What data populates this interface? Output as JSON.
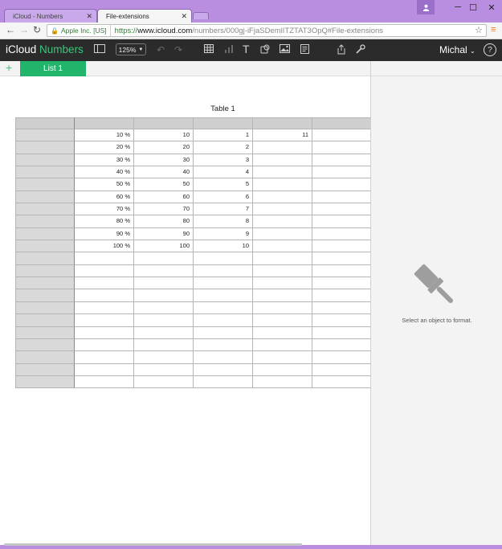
{
  "browser": {
    "tabs": [
      {
        "title": "iCloud - Numbers",
        "active": false
      },
      {
        "title": "File-extensions",
        "active": true
      }
    ],
    "security_label": "Apple Inc. [US]",
    "url_scheme": "https://",
    "url_host": "www.icloud.com",
    "url_path": "/numbers/000gj-iFjaSDemlITZTAT3OpQ#File-extensions"
  },
  "app": {
    "brand_prefix": "iCloud",
    "brand_suffix": "Numbers",
    "zoom_label": "125%",
    "user_name": "Michal",
    "help_label": "?"
  },
  "sheets": {
    "add_label": "+",
    "tabs": [
      "List 1"
    ]
  },
  "table": {
    "title": "Table 1",
    "rows": [
      [
        "",
        "10 %",
        "10",
        "1",
        "11",
        ""
      ],
      [
        "",
        "20 %",
        "20",
        "2",
        "",
        ""
      ],
      [
        "",
        "30 %",
        "30",
        "3",
        "",
        ""
      ],
      [
        "",
        "40 %",
        "40",
        "4",
        "",
        ""
      ],
      [
        "",
        "50 %",
        "50",
        "5",
        "",
        ""
      ],
      [
        "",
        "60 %",
        "60",
        "6",
        "",
        ""
      ],
      [
        "",
        "70 %",
        "70",
        "7",
        "",
        ""
      ],
      [
        "",
        "80 %",
        "80",
        "8",
        "",
        ""
      ],
      [
        "",
        "90 %",
        "90",
        "9",
        "",
        ""
      ],
      [
        "",
        "100 %",
        "100",
        "10",
        "",
        ""
      ],
      [
        "",
        "",
        "",
        "",
        "",
        ""
      ],
      [
        "",
        "",
        "",
        "",
        "",
        ""
      ],
      [
        "",
        "",
        "",
        "",
        "",
        ""
      ],
      [
        "",
        "",
        "",
        "",
        "",
        ""
      ],
      [
        "",
        "",
        "",
        "",
        "",
        ""
      ],
      [
        "",
        "",
        "",
        "",
        "",
        ""
      ],
      [
        "",
        "",
        "",
        "",
        "",
        ""
      ],
      [
        "",
        "",
        "",
        "",
        "",
        ""
      ],
      [
        "",
        "",
        "",
        "",
        "",
        ""
      ],
      [
        "",
        "",
        "",
        "",
        "",
        ""
      ],
      [
        "",
        "",
        "",
        "",
        "",
        ""
      ]
    ]
  },
  "format_panel": {
    "message": "Select an object to format."
  },
  "colors": {
    "accent": "#21b56b",
    "brand_green": "#3cc47c",
    "window_frame": "#b98ee0",
    "toolbar_bg": "#2b2b2b"
  }
}
